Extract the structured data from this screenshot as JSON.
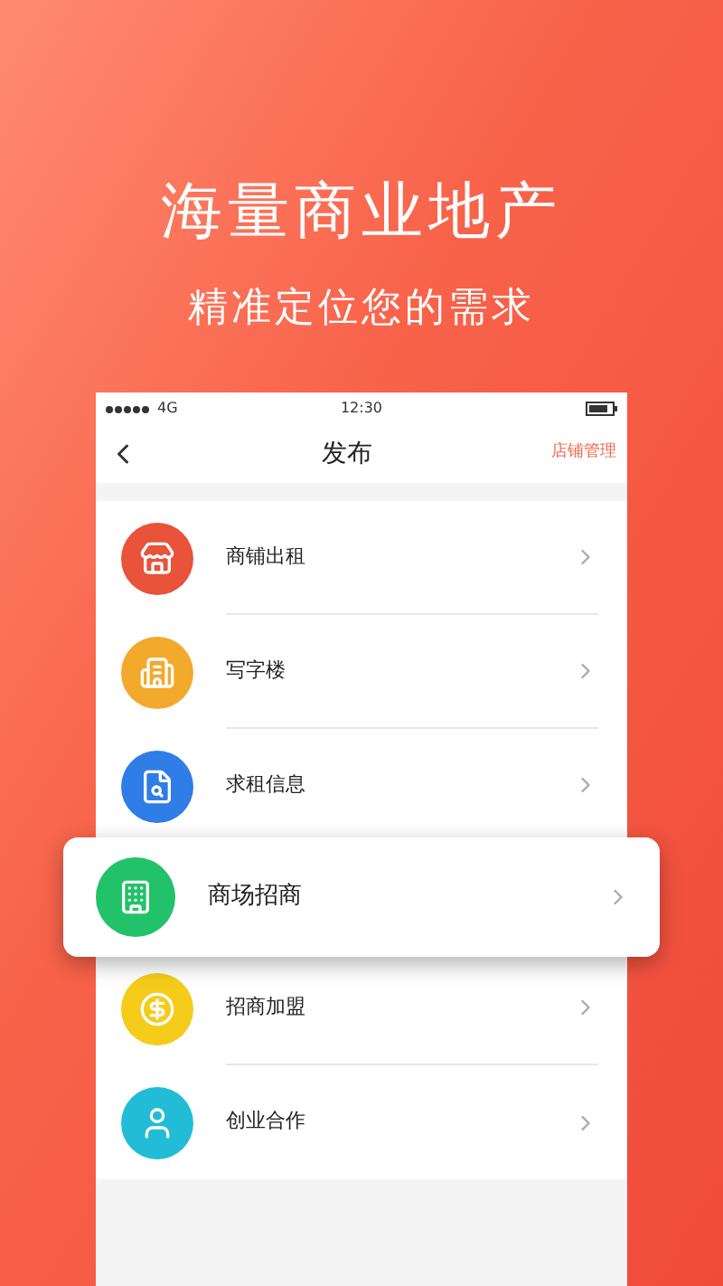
{
  "headline": "海量商业地产",
  "subheadline": "精准定位您的需求",
  "status_bar": {
    "signal": "4G",
    "time": "12:30"
  },
  "nav": {
    "title": "发布",
    "action": "店铺管理"
  },
  "items": [
    {
      "label": "商铺出租",
      "color": "#e8533a",
      "highlighted": false
    },
    {
      "label": "写字楼",
      "color": "#f3a92c",
      "highlighted": false
    },
    {
      "label": "求租信息",
      "color": "#2f7de6",
      "highlighted": false
    },
    {
      "label": "商场招商",
      "color": "#22c26a",
      "highlighted": true
    },
    {
      "label": "招商加盟",
      "color": "#f5cc1a",
      "highlighted": false
    },
    {
      "label": "创业合作",
      "color": "#22bcd6",
      "highlighted": false
    }
  ]
}
